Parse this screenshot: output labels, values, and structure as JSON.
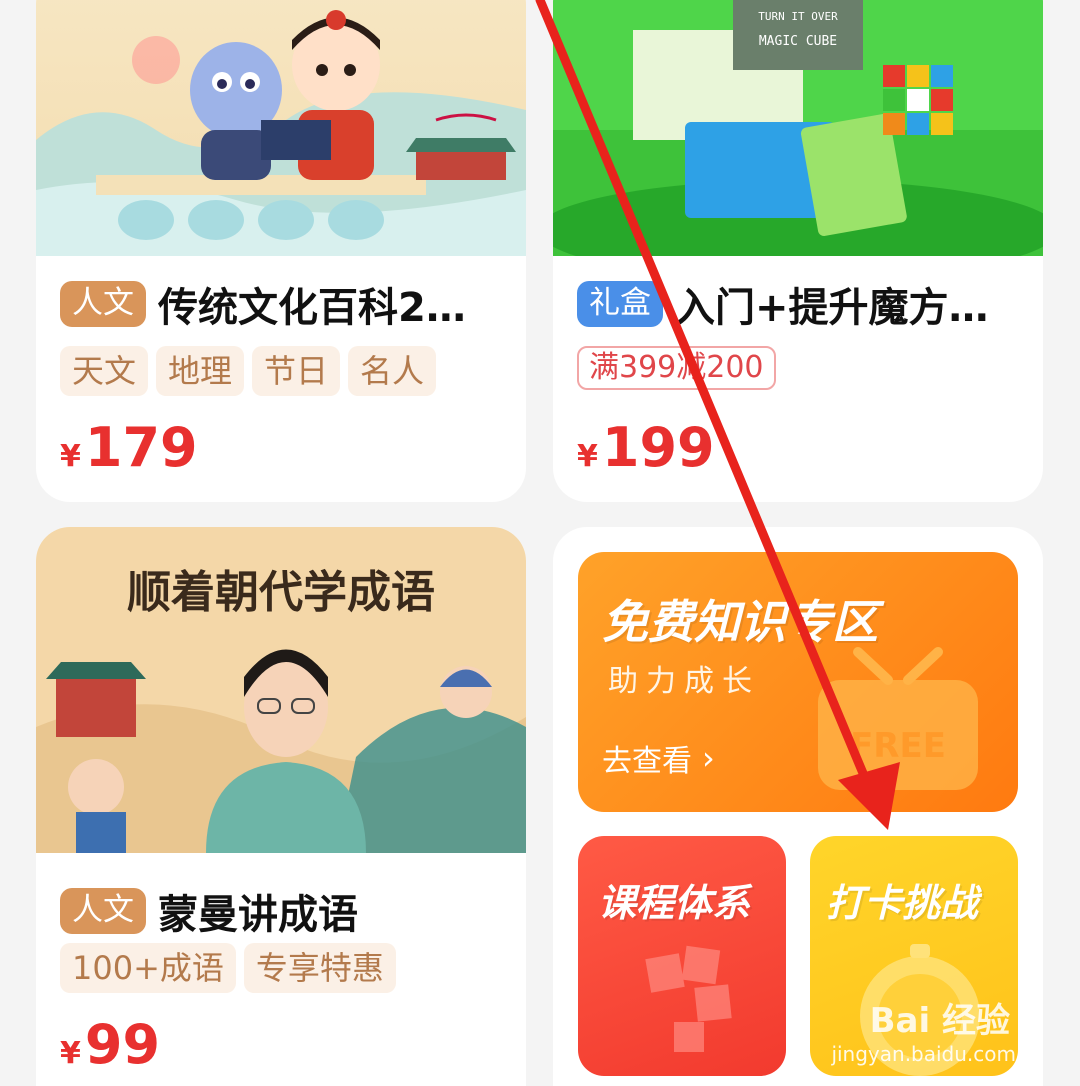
{
  "cards": [
    {
      "badge": "人文",
      "title": "传统文化百科2…",
      "tags": [
        "天文",
        "地理",
        "节日",
        "名人"
      ],
      "price_symbol": "¥",
      "price": "179"
    },
    {
      "badge": "礼盒",
      "title": "入门+提升魔方…",
      "promo": "满399减200",
      "price_symbol": "¥",
      "price": "199",
      "image_text": [
        "TURN IT OVER",
        "MAGIC CUBE"
      ]
    },
    {
      "badge": "人文",
      "title": "蒙曼讲成语",
      "tags": [
        "100+成语",
        "专享特惠"
      ],
      "price_symbol": "¥",
      "price": "99",
      "image_title": "顺着朝代学成语"
    }
  ],
  "tiles": {
    "free": {
      "title": "免费知识专区",
      "subtitle": "助力成长",
      "link": "去查看",
      "art": "FREE"
    },
    "course": {
      "title": "课程体系"
    },
    "checkin": {
      "title": "打卡挑战"
    }
  },
  "watermark": {
    "brand": "Bai 经验",
    "url": "jingyan.baidu.com"
  },
  "colors": {
    "price": "#e8302f",
    "badge_culture": "#d9955a",
    "badge_gift": "#4a8fe8",
    "arrow": "#e8231c"
  }
}
